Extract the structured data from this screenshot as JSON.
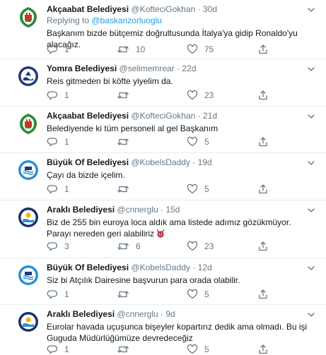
{
  "timeline": {
    "tweets": [
      {
        "avatar": "akcaabat-emblem",
        "name": "Akçaabat Belediyesi",
        "handle": "@KofteciGokhan",
        "separator": "·",
        "time": "30d",
        "replying_prefix": "Replying to",
        "replying_to": "@baskanzorluoglu",
        "text": "Başkanım bizde bütçemiz doğrultusunda İtalya'ya gidip Ronaldo'yu alacağız.",
        "reply_count": "1",
        "retweet_count": "10",
        "like_count": "75"
      },
      {
        "avatar": "yomra-emblem",
        "name": "Yomra Belediyesi",
        "handle": "@selimemrear",
        "separator": "·",
        "time": "22d",
        "text": "Reis gitmeden bi köfte yiyelim da.",
        "reply_count": "1",
        "retweet_count": "",
        "like_count": "23"
      },
      {
        "avatar": "akcaabat-emblem",
        "name": "Akçaabat Belediyesi",
        "handle": "@KofteciGokhan",
        "separator": "·",
        "time": "21d",
        "text": "Belediyende ki tüm personeli al gel Başkanım",
        "reply_count": "1",
        "retweet_count": "",
        "like_count": "5"
      },
      {
        "avatar": "buyuk-of-emblem",
        "name": "Büyük Of Belediyesi",
        "handle": "@KobelsDaddy",
        "separator": "·",
        "time": "19d",
        "text": "Çayı da bizde içelim.",
        "reply_count": "1",
        "retweet_count": "",
        "like_count": "5"
      },
      {
        "avatar": "arakli-emblem",
        "name": "Araklı Belediyesi",
        "handle": "@cnnerglu",
        "separator": "·",
        "time": "15d",
        "text": "Biz de 255 bin euroya loca aldık ama listede adımız gözükmüyor. Parayı nereden geri alabiliriz",
        "emoji": "devil-face-emoji",
        "reply_count": "3",
        "retweet_count": "6",
        "like_count": "23"
      },
      {
        "avatar": "buyuk-of-emblem",
        "name": "Büyük Of Belediyesi",
        "handle": "@KobelsDaddy",
        "separator": "·",
        "time": "12d",
        "text": "Siz bi Atçılık Dairesine başvurun para orada olabilir.",
        "reply_count": "1",
        "retweet_count": "",
        "like_count": "5"
      },
      {
        "avatar": "arakli-emblem",
        "name": "Araklı Belediyesi",
        "handle": "@cnnerglu",
        "separator": "·",
        "time": "9d",
        "text": "Eurolar havada uçuşunca bişeyler kopartırız dedik ama olmadı. Bu işi Guguda Müdürlüğümüze devredeceğiz",
        "reply_count": "1",
        "retweet_count": "",
        "like_count": "5"
      }
    ]
  },
  "colors": {
    "text": "#14171a",
    "muted": "#657786",
    "link": "#1da1f2",
    "divider": "#e6ecf0",
    "akcaabat_green": "#2e8b3a",
    "yomra_navy": "#1f3a7a",
    "of_blue": "#2d8fd0",
    "arakli_navy": "#1b2f6e"
  }
}
